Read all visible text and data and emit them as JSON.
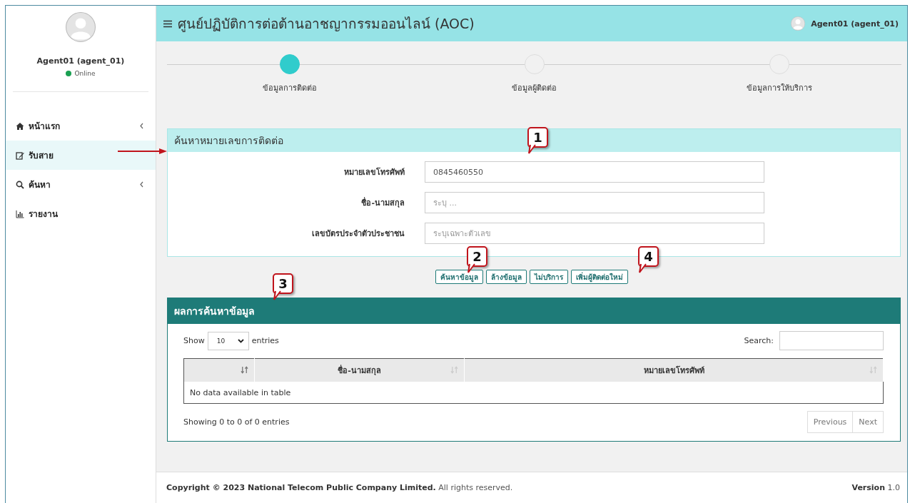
{
  "sidebar": {
    "user_name": "Agent01 (agent_01)",
    "status": {
      "label": "Online",
      "online": true
    },
    "menu": [
      {
        "label": "หน้าแรก",
        "kind": "home",
        "expandable": true,
        "selected": false
      },
      {
        "label": "รับสาย",
        "kind": "edit",
        "expandable": false,
        "selected": true
      },
      {
        "label": "ค้นหา",
        "kind": "search",
        "expandable": true,
        "selected": false
      },
      {
        "label": "รายงาน",
        "kind": "chart",
        "expandable": false,
        "selected": false
      }
    ]
  },
  "header": {
    "title": "ศูนย์ปฏิบัติการต่อต้านอาชญากรรมออนไลน์ (AOC)",
    "user": "Agent01 (agent_01)"
  },
  "steps": [
    {
      "label": "ข้อมูลการติดต่อ",
      "selected": true
    },
    {
      "label": "ข้อมูลผู้ติดต่อ",
      "selected": false
    },
    {
      "label": "ข้อมูลการให้บริการ",
      "selected": false
    }
  ],
  "search_panel": {
    "title": "ค้นหาหมายเลขการติดต่อ",
    "fields": [
      {
        "label": "หมายเลขโทรศัพท์",
        "value": "0845460550"
      },
      {
        "label": "ชื่อ-นามสกุล",
        "placeholder": "ระบุ ..."
      },
      {
        "label": "เลขบัตรประจำตัวประชาชน",
        "placeholder": "ระบุเฉพาะตัวเลข"
      }
    ]
  },
  "buttons": [
    "ค้นหาข้อมูล",
    "ล้างข้อมูล",
    "ไม่บริการ",
    "เพิ่มผู้ติดต่อใหม่"
  ],
  "results": {
    "title": "ผลการค้นหาข้อมูล",
    "show_label": "Show",
    "page_size": "10",
    "entries_label": "entries",
    "search_label": "Search:",
    "columns": [
      "ชื่อ-นามสกุล",
      "หมายเลขโทรศัพท์"
    ],
    "empty_message": "No data available in table",
    "info": "Showing 0 to 0 of 0 entries",
    "pagination": [
      "Previous",
      "Next"
    ]
  },
  "footer": {
    "copyright": "**Copyright © 2023 National Telecom Public Company Limited.** All rights reserved.",
    "version": "**Version** 1.0"
  },
  "callouts": [
    "1",
    "2",
    "3",
    "4"
  ]
}
